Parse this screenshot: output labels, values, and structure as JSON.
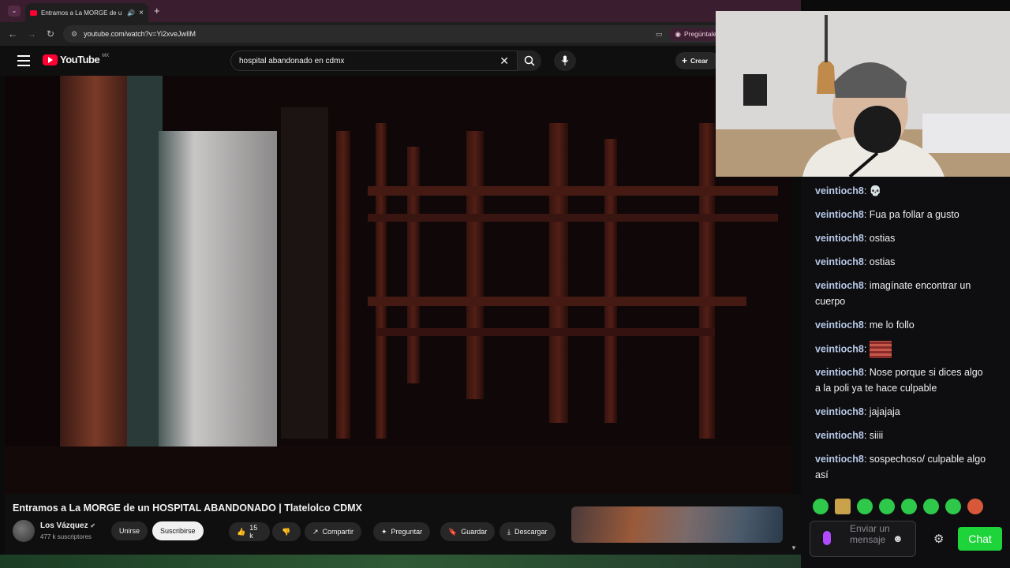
{
  "browser": {
    "tab_title": "Entramos a La MORGE de u",
    "url": "youtube.com/watch?v=Yi2xveJwIlM",
    "ask_google": "Pregúntale a Google",
    "new_tab": "+"
  },
  "youtube": {
    "logo": "YouTube",
    "country": "MX",
    "search_query": "hospital abandonado en cdmx",
    "create_label": "Crear"
  },
  "video": {
    "title": "Entramos a La MORGE de un HOSPITAL ABANDONADO | Tlatelolco CDMX",
    "channel": "Los Vázquez",
    "subscribers": "477 k suscriptores",
    "join_label": "Unirse",
    "subscribe_label": "Suscribirse",
    "likes": "15 k",
    "share_label": "Compartir",
    "ask_label": "Preguntar",
    "save_label": "Guardar",
    "download_label": "Descargar"
  },
  "chat": {
    "messages": [
      {
        "user": "veintioch8",
        "text": "💀"
      },
      {
        "user": "veintioch8",
        "text": "Fua pa follar a gusto"
      },
      {
        "user": "veintioch8",
        "text": "ostias"
      },
      {
        "user": "veintioch8",
        "text": "ostias"
      },
      {
        "user": "veintioch8",
        "text": "imagínate encontrar un cuerpo"
      },
      {
        "user": "veintioch8",
        "text": "me lo follo"
      },
      {
        "user": "veintioch8",
        "text": ""
      },
      {
        "user": "veintioch8",
        "text": "Nose porque si dices algo a la poli ya te hace culpable"
      },
      {
        "user": "veintioch8",
        "text": "jajajaja"
      },
      {
        "user": "veintioch8",
        "text": "siiii"
      },
      {
        "user": "veintioch8",
        "text": "sospechoso/ culpable algo así"
      }
    ],
    "input_placeholder": "Enviar un mensaje",
    "chat_button": "Chat"
  },
  "colors": {
    "chat_button": "#1dd43a",
    "username": "#b7c8e8",
    "youtube_red": "#ff0033"
  }
}
